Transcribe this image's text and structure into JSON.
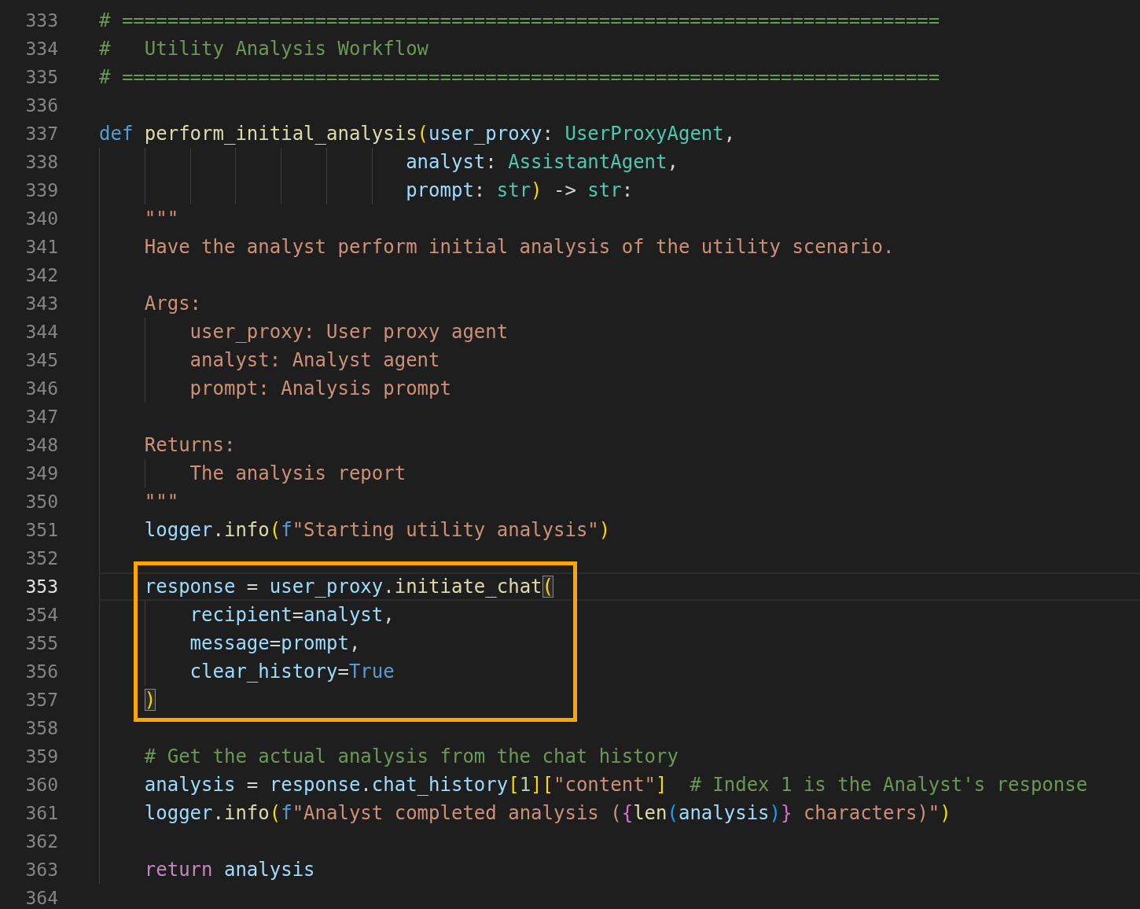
{
  "editor": {
    "lines": [
      {
        "number": "333",
        "current": false,
        "tokens": [
          {
            "kind": "comment",
            "text": "# ========================================================================"
          }
        ]
      },
      {
        "number": "334",
        "current": false,
        "tokens": [
          {
            "kind": "comment",
            "text": "#   Utility Analysis Workflow"
          }
        ]
      },
      {
        "number": "335",
        "current": false,
        "tokens": [
          {
            "kind": "comment",
            "text": "# ========================================================================"
          }
        ]
      },
      {
        "number": "336",
        "current": false
      },
      {
        "number": "337",
        "current": false,
        "tokens": [
          {
            "kind": "keyword",
            "text": "def "
          },
          {
            "kind": "function",
            "text": "perform_initial_analysis"
          },
          {
            "kind": "bracket",
            "text": "("
          },
          {
            "kind": "variable",
            "text": "user_proxy"
          },
          {
            "kind": "plain",
            "text": ": "
          },
          {
            "kind": "type",
            "text": "UserProxyAgent"
          },
          {
            "kind": "plain",
            "text": ","
          }
        ]
      },
      {
        "number": "338",
        "current": false,
        "tokens": [
          {
            "kind": "variable",
            "text": "                           analyst"
          },
          {
            "kind": "plain",
            "text": ": "
          },
          {
            "kind": "type",
            "text": "AssistantAgent"
          },
          {
            "kind": "plain",
            "text": ","
          }
        ]
      },
      {
        "number": "339",
        "current": false,
        "tokens": [
          {
            "kind": "variable",
            "text": "                           prompt"
          },
          {
            "kind": "plain",
            "text": ": "
          },
          {
            "kind": "type",
            "text": "str"
          },
          {
            "kind": "bracket",
            "text": ")"
          },
          {
            "kind": "plain",
            "text": " -> "
          },
          {
            "kind": "type",
            "text": "str"
          },
          {
            "kind": "plain",
            "text": ":"
          }
        ]
      },
      {
        "number": "340",
        "current": false,
        "tokens": [
          {
            "kind": "string",
            "text": "    \"\"\""
          }
        ]
      },
      {
        "number": "341",
        "current": false,
        "tokens": [
          {
            "kind": "string",
            "text": "    Have the analyst perform initial analysis of the utility scenario."
          }
        ]
      },
      {
        "number": "342",
        "current": false
      },
      {
        "number": "343",
        "current": false,
        "tokens": [
          {
            "kind": "string",
            "text": "    Args:"
          }
        ]
      },
      {
        "number": "344",
        "current": false,
        "tokens": [
          {
            "kind": "string",
            "text": "        user_proxy: User proxy agent"
          }
        ]
      },
      {
        "number": "345",
        "current": false,
        "tokens": [
          {
            "kind": "string",
            "text": "        analyst: Analyst agent"
          }
        ]
      },
      {
        "number": "346",
        "current": false,
        "tokens": [
          {
            "kind": "string",
            "text": "        prompt: Analysis prompt"
          }
        ]
      },
      {
        "number": "347",
        "current": false
      },
      {
        "number": "348",
        "current": false,
        "tokens": [
          {
            "kind": "string",
            "text": "    Returns:"
          }
        ]
      },
      {
        "number": "349",
        "current": false,
        "tokens": [
          {
            "kind": "string",
            "text": "        The analysis report"
          }
        ]
      },
      {
        "number": "350",
        "current": false,
        "tokens": [
          {
            "kind": "string",
            "text": "    \"\"\""
          }
        ]
      },
      {
        "number": "351",
        "current": false,
        "tokens": [
          {
            "kind": "variable",
            "text": "    logger"
          },
          {
            "kind": "plain",
            "text": "."
          },
          {
            "kind": "function",
            "text": "info"
          },
          {
            "kind": "bracket",
            "text": "("
          },
          {
            "kind": "keyword",
            "text": "f"
          },
          {
            "kind": "string",
            "text": "\"Starting utility analysis\""
          },
          {
            "kind": "bracket",
            "text": ")"
          }
        ]
      },
      {
        "number": "352",
        "current": false
      },
      {
        "number": "353",
        "current": true,
        "boxed": true,
        "tokens": [
          {
            "kind": "variable",
            "text": "    response"
          },
          {
            "kind": "plain",
            "text": " = "
          },
          {
            "kind": "variable",
            "text": "user_proxy"
          },
          {
            "kind": "plain",
            "text": "."
          },
          {
            "kind": "function",
            "text": "initiate_chat"
          },
          {
            "kind": "bracket-match",
            "text": "("
          }
        ]
      },
      {
        "number": "354",
        "current": false,
        "boxed": true,
        "tokens": [
          {
            "kind": "variable",
            "text": "        recipient"
          },
          {
            "kind": "plain",
            "text": "="
          },
          {
            "kind": "variable",
            "text": "analyst"
          },
          {
            "kind": "plain",
            "text": ","
          }
        ]
      },
      {
        "number": "355",
        "current": false,
        "boxed": true,
        "tokens": [
          {
            "kind": "variable",
            "text": "        message"
          },
          {
            "kind": "plain",
            "text": "="
          },
          {
            "kind": "variable",
            "text": "prompt"
          },
          {
            "kind": "plain",
            "text": ","
          }
        ]
      },
      {
        "number": "356",
        "current": false,
        "boxed": true,
        "tokens": [
          {
            "kind": "variable",
            "text": "        clear_history"
          },
          {
            "kind": "plain",
            "text": "="
          },
          {
            "kind": "constant",
            "text": "True"
          }
        ]
      },
      {
        "number": "357",
        "current": false,
        "boxed": true,
        "tokens": [
          {
            "kind": "bracket-match",
            "text": "    )"
          }
        ]
      },
      {
        "number": "358",
        "current": false
      },
      {
        "number": "359",
        "current": false,
        "tokens": [
          {
            "kind": "comment",
            "text": "    # Get the actual analysis from the chat history"
          }
        ]
      },
      {
        "number": "360",
        "current": false,
        "tokens": [
          {
            "kind": "variable",
            "text": "    analysis"
          },
          {
            "kind": "plain",
            "text": " = "
          },
          {
            "kind": "variable",
            "text": "response"
          },
          {
            "kind": "plain",
            "text": "."
          },
          {
            "kind": "variable",
            "text": "chat_history"
          },
          {
            "kind": "bracket",
            "text": "["
          },
          {
            "kind": "number",
            "text": "1"
          },
          {
            "kind": "bracket",
            "text": "]["
          },
          {
            "kind": "string",
            "text": "\"content\""
          },
          {
            "kind": "bracket",
            "text": "]"
          },
          {
            "kind": "comment",
            "text": "  # Index 1 is the Analyst's response"
          }
        ]
      },
      {
        "number": "361",
        "current": false,
        "tokens": [
          {
            "kind": "variable",
            "text": "    logger"
          },
          {
            "kind": "plain",
            "text": "."
          },
          {
            "kind": "function",
            "text": "info"
          },
          {
            "kind": "bracket",
            "text": "("
          },
          {
            "kind": "keyword",
            "text": "f"
          },
          {
            "kind": "string",
            "text": "\"Analyst completed analysis ("
          },
          {
            "kind": "bracket-2",
            "text": "{"
          },
          {
            "kind": "function",
            "text": "len"
          },
          {
            "kind": "bracket-3",
            "text": "("
          },
          {
            "kind": "variable",
            "text": "analysis"
          },
          {
            "kind": "bracket-3",
            "text": ")"
          },
          {
            "kind": "bracket-2",
            "text": "}"
          },
          {
            "kind": "string",
            "text": " characters)\""
          },
          {
            "kind": "bracket",
            "text": ")"
          }
        ]
      },
      {
        "number": "362",
        "current": false
      },
      {
        "number": "363",
        "current": false,
        "tokens": [
          {
            "kind": "control",
            "text": "    return "
          },
          {
            "kind": "variable",
            "text": "analysis"
          }
        ]
      },
      {
        "number": "364",
        "current": false
      }
    ]
  }
}
